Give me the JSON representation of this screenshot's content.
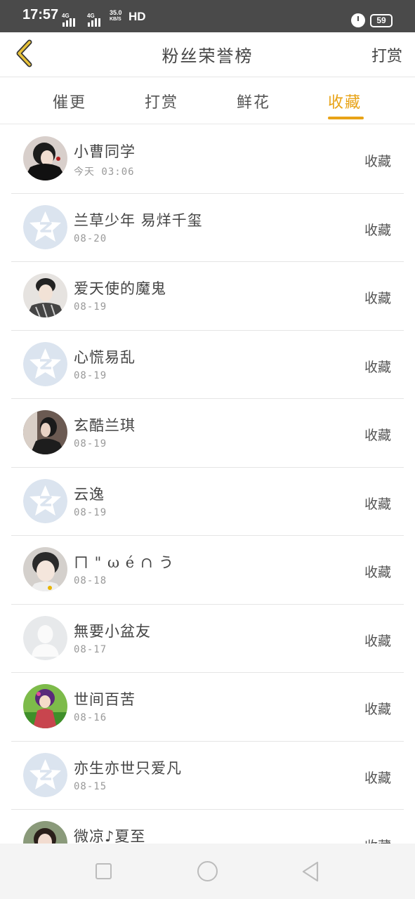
{
  "status_bar": {
    "time": "17:57",
    "network1": "4G",
    "network2": "4G",
    "speed_value": "35.0",
    "speed_unit": "KB/S",
    "hd": "HD",
    "battery": "59"
  },
  "header": {
    "title": "粉丝荣誉榜",
    "action_label": "打赏",
    "accent_color": "#e8a317"
  },
  "tabs": [
    {
      "label": "催更",
      "active": false
    },
    {
      "label": "打赏",
      "active": false
    },
    {
      "label": "鲜花",
      "active": false
    },
    {
      "label": "收藏",
      "active": true
    }
  ],
  "fans": [
    {
      "name": "小曹同学",
      "date": "今天 03:06",
      "action": "收藏",
      "avatar": "photo-avatar"
    },
    {
      "name": "兰草少年 易烊千玺",
      "date": "08-20",
      "action": "收藏",
      "avatar": "default-avatar"
    },
    {
      "name": "爱天使的魔鬼",
      "date": "08-19",
      "action": "收藏",
      "avatar": "photo-avatar"
    },
    {
      "name": "心慌易乱",
      "date": "08-19",
      "action": "收藏",
      "avatar": "default-avatar"
    },
    {
      "name": "玄酷兰琪",
      "date": "08-19",
      "action": "收藏",
      "avatar": "photo-avatar"
    },
    {
      "name": "云逸",
      "date": "08-19",
      "action": "收藏",
      "avatar": "default-avatar"
    },
    {
      "name": "ㄇ \" ω é ∩ う",
      "date": "08-18",
      "action": "收藏",
      "avatar": "photo-avatar"
    },
    {
      "name": "無要小盆友",
      "date": "08-17",
      "action": "收藏",
      "avatar": "blank-avatar"
    },
    {
      "name": "世间百苦",
      "date": "08-16",
      "action": "收藏",
      "avatar": "photo-avatar"
    },
    {
      "name": "亦生亦世只爱凡",
      "date": "08-15",
      "action": "收藏",
      "avatar": "default-avatar"
    },
    {
      "name": "微凉♪夏至",
      "date": "",
      "action": "收藏",
      "avatar": "photo-avatar"
    }
  ]
}
